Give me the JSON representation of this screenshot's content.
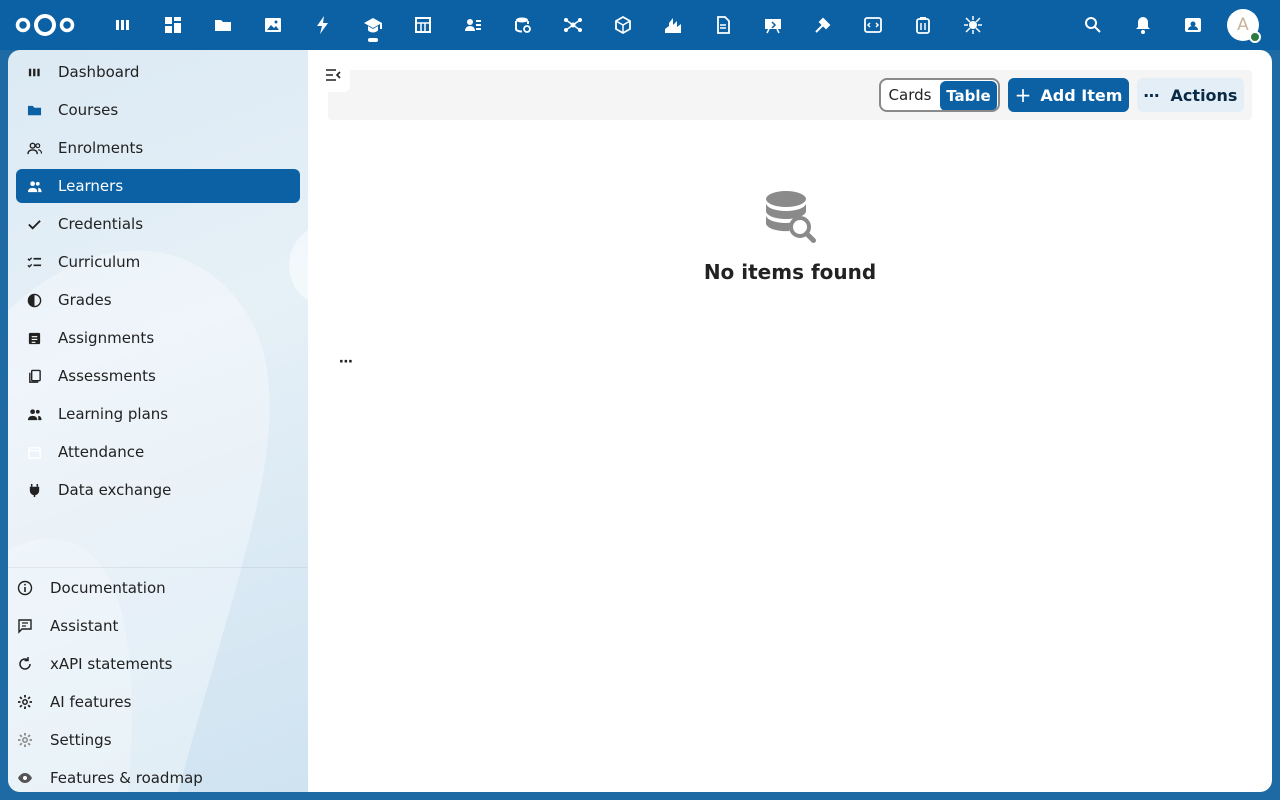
{
  "header": {
    "logo": "nextcloud-logo",
    "apps": [
      {
        "name": "dashboard-app-icon",
        "active": false
      },
      {
        "name": "grid-app-icon",
        "active": false
      },
      {
        "name": "files-app-icon",
        "active": false
      },
      {
        "name": "photos-app-icon",
        "active": false
      },
      {
        "name": "activity-app-icon",
        "active": false
      },
      {
        "name": "education-app-icon",
        "active": true
      },
      {
        "name": "tables-app-icon",
        "active": false
      },
      {
        "name": "contacts-list-app-icon",
        "active": false
      },
      {
        "name": "database-app-icon",
        "active": false
      },
      {
        "name": "network-app-icon",
        "active": false
      },
      {
        "name": "cube-app-icon",
        "active": false
      },
      {
        "name": "chart-app-icon",
        "active": false
      },
      {
        "name": "document-app-icon",
        "active": false
      },
      {
        "name": "whiteboard-app-icon",
        "active": false
      },
      {
        "name": "tools-app-icon",
        "active": false
      },
      {
        "name": "code-app-icon",
        "active": false
      },
      {
        "name": "archive-app-icon",
        "active": false
      },
      {
        "name": "bug-app-icon",
        "active": false
      }
    ],
    "avatar_letter": "A"
  },
  "sidebar": {
    "items": [
      {
        "label": "Dashboard",
        "icon": "dashboard-icon",
        "active": false
      },
      {
        "label": "Courses",
        "icon": "folder-icon",
        "active": false
      },
      {
        "label": "Enrolments",
        "icon": "users-icon",
        "active": false
      },
      {
        "label": "Learners",
        "icon": "users-icon",
        "active": true
      },
      {
        "label": "Credentials",
        "icon": "check-icon",
        "active": false
      },
      {
        "label": "Curriculum",
        "icon": "checklist-icon",
        "active": false
      },
      {
        "label": "Grades",
        "icon": "contrast-icon",
        "active": false
      },
      {
        "label": "Assignments",
        "icon": "note-icon",
        "active": false
      },
      {
        "label": "Assessments",
        "icon": "copy-icon",
        "active": false
      },
      {
        "label": "Learning plans",
        "icon": "users-icon",
        "active": false
      },
      {
        "label": "Attendance",
        "icon": "calendar-icon",
        "active": false
      },
      {
        "label": "Data exchange",
        "icon": "plug-icon",
        "active": false
      }
    ],
    "bottom_items": [
      {
        "label": "Documentation",
        "icon": "info-icon"
      },
      {
        "label": "Assistant",
        "icon": "chat-icon"
      },
      {
        "label": "xAPI statements",
        "icon": "refresh-icon"
      },
      {
        "label": "AI features",
        "icon": "gear-icon"
      },
      {
        "label": "Settings",
        "icon": "settings-icon"
      },
      {
        "label": "Features & roadmap",
        "icon": "eye-icon"
      }
    ]
  },
  "toolbar": {
    "view_cards": "Cards",
    "view_table": "Table",
    "add_label": "Add Item",
    "add_plus": "+",
    "actions_label": "Actions",
    "actions_dots": "⋯"
  },
  "empty": {
    "title": "No items found"
  },
  "more_label": "⋯",
  "colors": {
    "primary": "#0b61a4",
    "sidebar_bg": "#dceaf4",
    "page_bg": "#1d6aa5"
  }
}
